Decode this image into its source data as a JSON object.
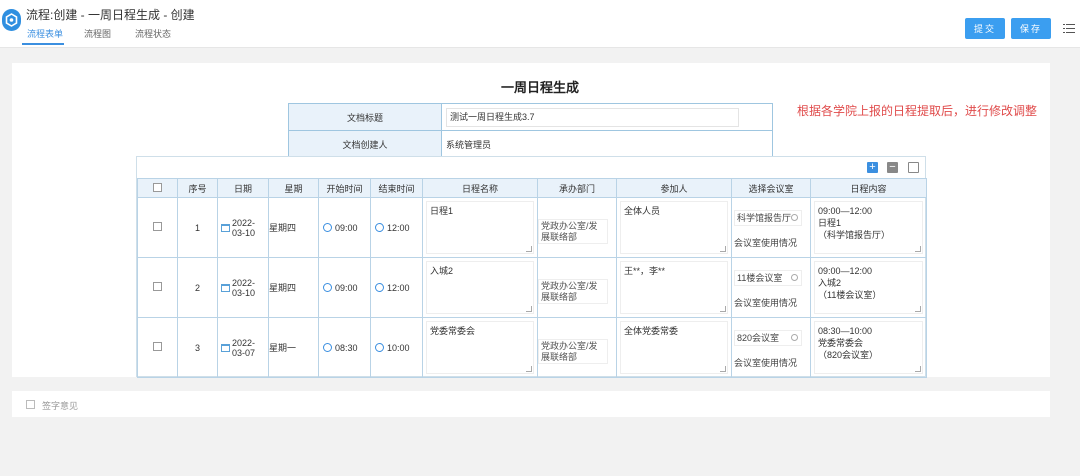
{
  "header": {
    "title": "流程:创建 - 一周日程生成 - 创建",
    "tabs": [
      {
        "label": "流程表单"
      },
      {
        "label": "流程图"
      },
      {
        "label": "流程状态"
      }
    ],
    "submit_label": "提交",
    "save_label": "保存"
  },
  "form": {
    "title": "一周日程生成",
    "note": "根据各学院上报的日程提取后，进行修改调整",
    "doc_title_label": "文档标题",
    "doc_title_value": "测试一周日程生成3.7",
    "creator_label": "文档创建人",
    "creator_value": "系统管理员"
  },
  "grid": {
    "columns": [
      "序号",
      "日期",
      "星期",
      "开始时间",
      "结束时间",
      "日程名称",
      "承办部门",
      "参加人",
      "选择会议室",
      "日程内容"
    ],
    "rows": [
      {
        "no": "1",
        "date": "2022-03-10",
        "weekday": "星期四",
        "start": "09:00",
        "end": "12:00",
        "name": "日程1",
        "dept": "党政办公室/发展联络部",
        "attendees": "全体人员",
        "room": "科学馆报告厅",
        "room_link": "会议室使用情况",
        "content": "09:00—12:00\n日程1\n（科学馆报告厅）"
      },
      {
        "no": "2",
        "date": "2022-03-10",
        "weekday": "星期四",
        "start": "09:00",
        "end": "12:00",
        "name": "入城2",
        "dept": "党政办公室/发展联络部",
        "attendees": "王**，李**",
        "room": "11楼会议室",
        "room_link": "会议室使用情况",
        "content": "09:00—12:00\n入城2\n（11楼会议室）"
      },
      {
        "no": "3",
        "date": "2022-03-07",
        "weekday": "星期一",
        "start": "08:30",
        "end": "10:00",
        "name": "党委常委会",
        "dept": "党政办公室/发展联络部",
        "attendees": "全体党委常委",
        "room": "820会议室",
        "room_link": "会议室使用情况",
        "content": "08:30—10:00\n党委常委会\n（820会议室）"
      }
    ]
  },
  "signature": {
    "label": "签字意见"
  }
}
